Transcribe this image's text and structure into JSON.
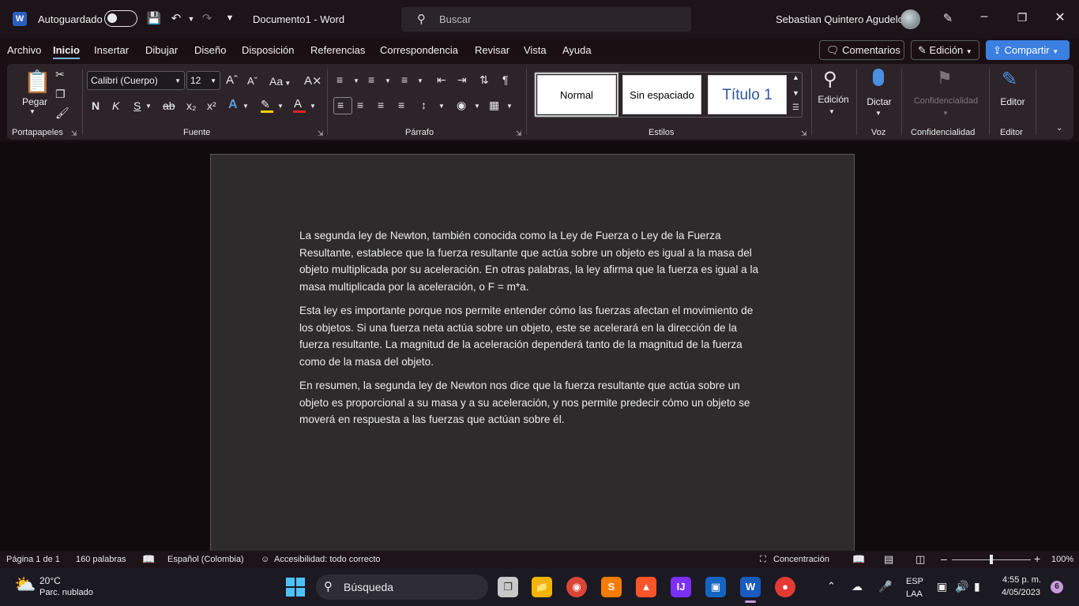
{
  "titlebar": {
    "autosave_label": "Autoguardado",
    "doc_title": "Documento1  -  Word",
    "search_placeholder": "Buscar",
    "user_name": "Sebastian Quintero Agudelo"
  },
  "menu": {
    "items": [
      "Archivo",
      "Inicio",
      "Insertar",
      "Dibujar",
      "Diseño",
      "Disposición",
      "Referencias",
      "Correspondencia",
      "Revisar",
      "Vista",
      "Ayuda"
    ],
    "active": "Inicio",
    "comments_label": "Comentarios",
    "editing_label": "Edición",
    "share_label": "Compartir"
  },
  "ribbon": {
    "groups": {
      "clipboard": "Portapapeles",
      "font": "Fuente",
      "paragraph": "Párrafo",
      "styles": "Estilos",
      "voice": "Voz",
      "sensitivity": "Confidencialidad",
      "editor": "Editor"
    },
    "paste_label": "Pegar",
    "font_name": "Calibri (Cuerpo)",
    "font_size": "12",
    "bold": "N",
    "italic": "K",
    "underline": "S",
    "strike": "ab",
    "change_case": "Aa",
    "styles": [
      "Normal",
      "Sin espaciado",
      "Título 1"
    ],
    "editing_label": "Edición",
    "dictate_label": "Dictar",
    "sensitivity_label": "Confidencialidad",
    "editor_label": "Editor",
    "colors": {
      "highlight": "#f5d000",
      "font_color": "#e0202a",
      "title_style": "#2f5597",
      "accent": "#3b7fe0"
    }
  },
  "document": {
    "paragraphs": [
      "La segunda ley de Newton, también conocida como la Ley de Fuerza o Ley de la Fuerza Resultante, establece que la fuerza resultante que actúa sobre un objeto es igual a la masa del objeto multiplicada por su aceleración. En otras palabras, la ley afirma que la fuerza es igual a la masa multiplicada por la aceleración, o F = m*a.",
      "Esta ley es importante porque nos permite entender cómo las fuerzas afectan el movimiento de los objetos. Si una fuerza neta actúa sobre un objeto, este se acelerará en la dirección de la fuerza resultante. La magnitud de la aceleración dependerá tanto de la magnitud de la fuerza como de la masa del objeto.",
      "En resumen, la segunda ley de Newton nos dice que la fuerza resultante que actúa sobre un objeto es proporcional a su masa y a su aceleración, y nos permite predecir cómo un objeto se moverá en respuesta a las fuerzas que actúan sobre él."
    ]
  },
  "statusbar": {
    "page": "Página 1 de 1",
    "words": "160 palabras",
    "language": "Español (Colombia)",
    "accessibility": "Accesibilidad: todo correcto",
    "focus": "Concentración",
    "zoom": "100%"
  },
  "taskbar": {
    "weather_temp": "20°C",
    "weather_desc": "Parc. nublado",
    "search_label": "Búsqueda",
    "lang_top": "ESP",
    "lang_bottom": "LAA",
    "time": "4:55 p. m.",
    "date": "4/05/2023",
    "notifications": "6"
  }
}
